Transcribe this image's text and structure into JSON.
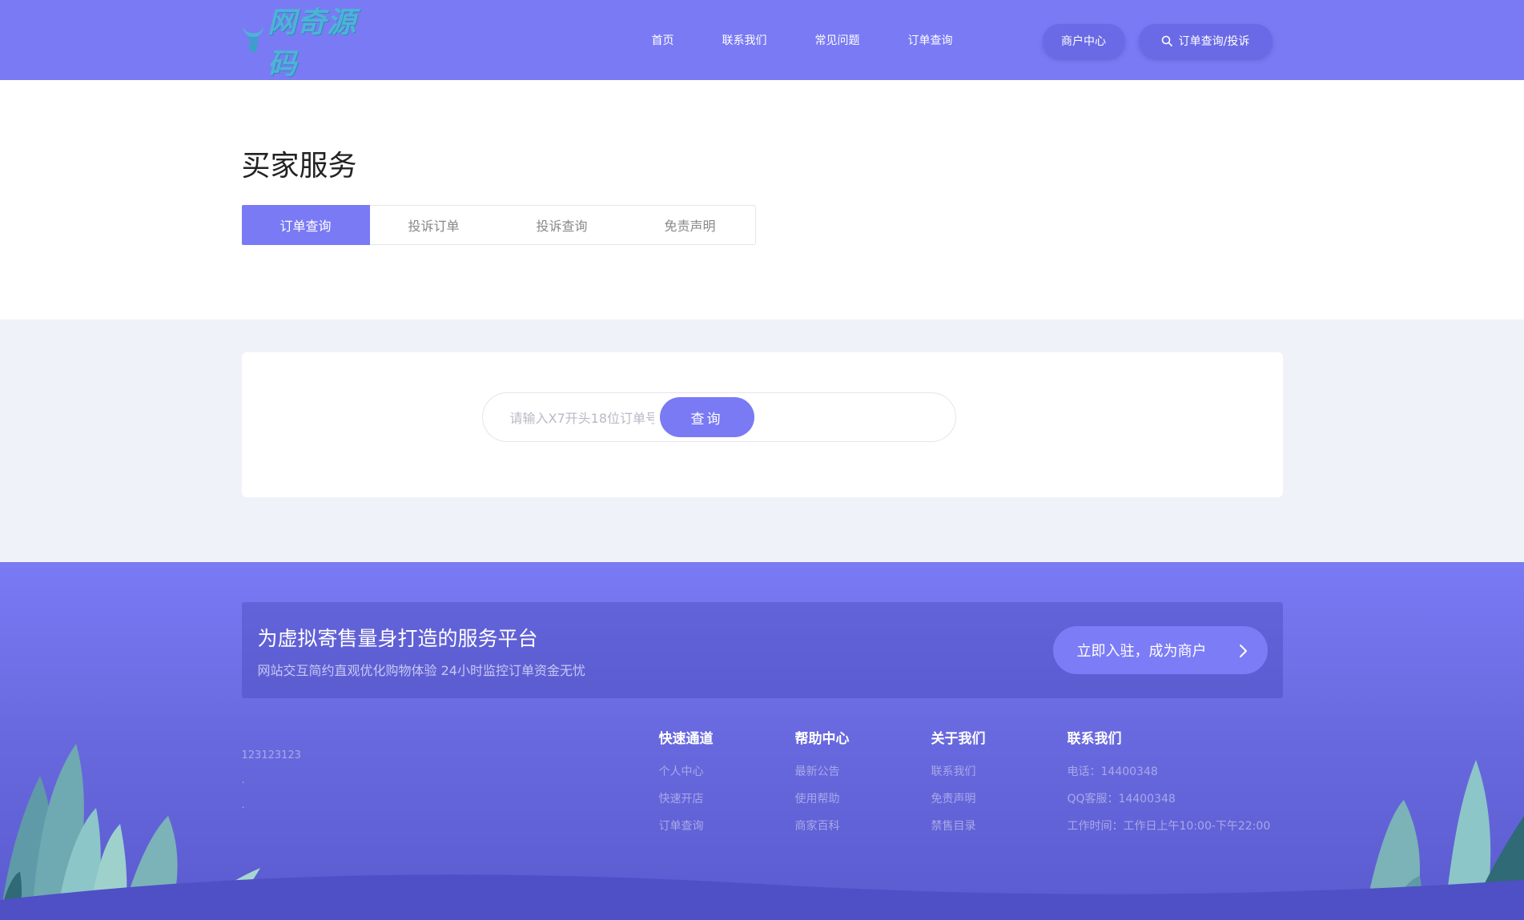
{
  "header": {
    "logo_text": "网奇源码",
    "nav": [
      {
        "label": "首页"
      },
      {
        "label": "联系我们"
      },
      {
        "label": "常见问题"
      },
      {
        "label": "订单查询"
      }
    ],
    "merchant_button": "商户中心",
    "search_button": "订单查询/投诉"
  },
  "main": {
    "title": "买家服务",
    "tabs": [
      {
        "label": "订单查询",
        "active": true
      },
      {
        "label": "投诉订单",
        "active": false
      },
      {
        "label": "投诉查询",
        "active": false
      },
      {
        "label": "免责声明",
        "active": false
      }
    ],
    "query": {
      "placeholder": "请输入X7开头18位订单号",
      "button": "查询"
    }
  },
  "footer": {
    "promo_title": "为虚拟寄售量身打造的服务平台",
    "promo_subtitle": "网站交互简约直观优化购物体验 24小时监控订单资金无忧",
    "promo_button": "立即入驻，成为商户",
    "info_lines": [
      "123123123",
      ".",
      "."
    ],
    "columns": [
      {
        "title": "快速通道",
        "links": [
          "个人中心",
          "快速开店",
          "订单查询"
        ]
      },
      {
        "title": "帮助中心",
        "links": [
          "最新公告",
          "使用帮助",
          "商家百科"
        ]
      },
      {
        "title": "关于我们",
        "links": [
          "联系我们",
          "免责声明",
          "禁售目录"
        ]
      },
      {
        "title": "联系我们",
        "links": [
          "电话：14400348",
          "QQ客服：14400348",
          "工作时间：工作日上午10:00-下午22:00"
        ]
      }
    ]
  },
  "colors": {
    "primary": "#7a7af5",
    "page_bg": "#eff3f9"
  }
}
